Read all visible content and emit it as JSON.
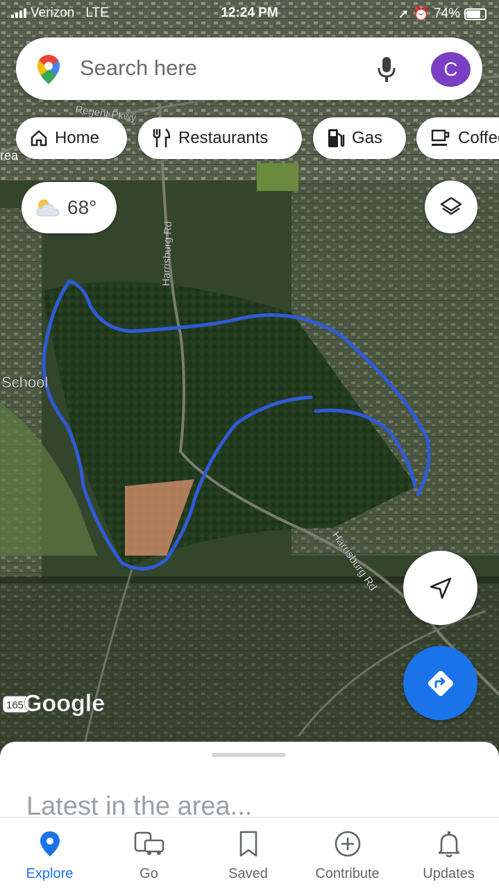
{
  "status_bar": {
    "carrier": "Verizon",
    "network": "LTE",
    "time": "12:24 PM",
    "battery": "74%"
  },
  "search": {
    "placeholder": "Search here",
    "avatar_letter": "C"
  },
  "chips": [
    {
      "label": "Home",
      "icon": "home-icon"
    },
    {
      "label": "Restaurants",
      "icon": "fork-knife-icon"
    },
    {
      "label": "Gas",
      "icon": "gas-pump-icon"
    },
    {
      "label": "Coffee",
      "icon": "coffee-cup-icon"
    }
  ],
  "weather": {
    "temp": "68°",
    "icon": "partly-cloudy-icon"
  },
  "map": {
    "labels": {
      "road1": "Harrisburg Rd",
      "road2": "Harrisburg Rd",
      "regent": "Regent Pkwy",
      "school": "School",
      "area": "rea",
      "route": "165"
    },
    "attribution": "Google",
    "route_color": "#2e5bd8"
  },
  "bottom_sheet": {
    "title": "Latest in the area..."
  },
  "nav": [
    {
      "label": "Explore",
      "icon": "pin-icon",
      "active": true
    },
    {
      "label": "Go",
      "icon": "commute-icon"
    },
    {
      "label": "Saved",
      "icon": "bookmark-icon"
    },
    {
      "label": "Contribute",
      "icon": "add-circle-icon"
    },
    {
      "label": "Updates",
      "icon": "bell-icon"
    }
  ],
  "colors": {
    "accent": "#1a73e8",
    "avatar": "#7b3fc4"
  }
}
